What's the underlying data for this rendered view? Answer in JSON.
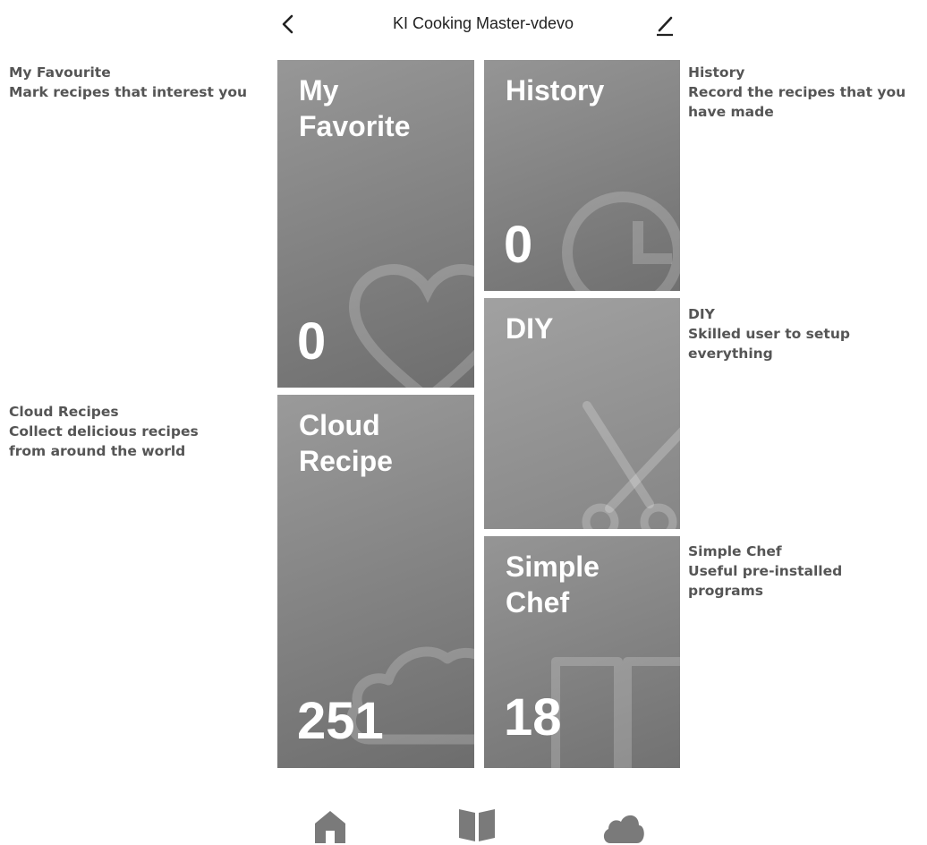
{
  "header": {
    "title": "KI Cooking Master-vdevo"
  },
  "annotations": {
    "favourite": {
      "heading": "My Favourite",
      "text": [
        "Mark recipes that interest you"
      ]
    },
    "history": {
      "heading": "History",
      "text": [
        "Record the recipes that you",
        "have made"
      ]
    },
    "diy": {
      "heading": "DIY",
      "text": [
        "Skilled user to setup",
        "everything"
      ]
    },
    "cloud": {
      "heading": "Cloud Recipes",
      "text": [
        "Collect delicious recipes",
        "from around the world"
      ]
    },
    "chef": {
      "heading": "Simple Chef",
      "text": [
        "Useful pre-installed",
        "programs"
      ]
    }
  },
  "tiles": {
    "favorite": {
      "title_lines": [
        "My",
        "Favorite"
      ],
      "count": "0",
      "icon": "heart-icon"
    },
    "history": {
      "title_lines": [
        "History"
      ],
      "count": "0",
      "icon": "clock-icon"
    },
    "diy": {
      "title_lines": [
        "DIY"
      ],
      "icon": "scissors-icon"
    },
    "cloud": {
      "title_lines": [
        "Cloud",
        "Recipe"
      ],
      "count": "251",
      "icon": "cloud-icon"
    },
    "chef": {
      "title_lines": [
        "Simple",
        "Chef"
      ],
      "count": "18",
      "icon": "book-icon"
    }
  },
  "nav": [
    {
      "icon": "home-icon"
    },
    {
      "icon": "book-icon"
    },
    {
      "icon": "cloud-icon"
    }
  ],
  "colors": {
    "tile_dark": "#6e6e6e",
    "tile_light": "#a1a1a1",
    "annotation_text": "#555555",
    "nav_icon": "#7a7a7a"
  }
}
